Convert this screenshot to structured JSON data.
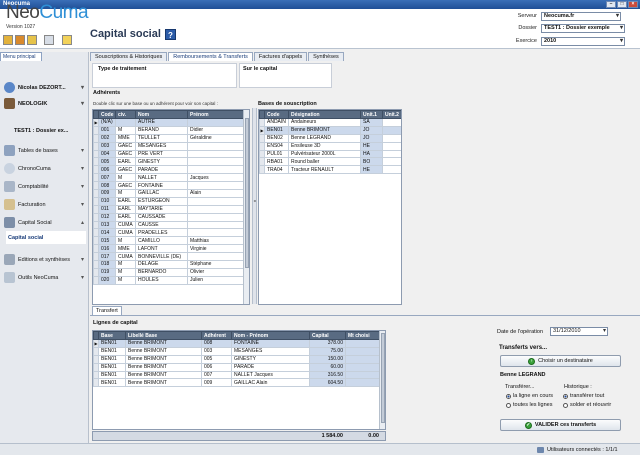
{
  "window": {
    "title": "Neocuma"
  },
  "header": {
    "logo_neo": "Neo",
    "logo_cuma": "Cuma",
    "version": "Version 1027",
    "page_title": "Capital social",
    "help": "?",
    "server_label": "Serveur",
    "server_value": "Neocuma.fr",
    "dossier_label": "Dossier",
    "dossier_value": "TEST1 : Dossier exemple",
    "exercice_label": "Exercice",
    "exercice_value": "2010"
  },
  "nav": {
    "tab_label": "Menu principal",
    "user": "Nicolas DEZORT...",
    "company": "NEOLOGIK",
    "dossier": "TEST1 : Dossier ex...",
    "items": [
      {
        "label": "Tables de bases"
      },
      {
        "label": "ChronoCuma"
      },
      {
        "label": "Comptabilité"
      },
      {
        "label": "Facturation"
      },
      {
        "label": "Capital Social"
      },
      {
        "label": "Capital social"
      },
      {
        "label": "Editions et synthèses"
      },
      {
        "label": "Outils NeoCuma"
      }
    ]
  },
  "tabs": [
    "Souscriptions & Historiques",
    "Remboursements & Transferts",
    "Factures d'appels",
    "Synthèses"
  ],
  "type_traitement": {
    "label": "Type de traitement"
  },
  "sur_capital": {
    "label": "Sur le capital"
  },
  "adherents": {
    "label": "Adhérents",
    "hint": "Double clic sur une base ou un adhérent pour voir son capital :",
    "columns": [
      "Code",
      "civ.",
      "Nom",
      "Prénom"
    ],
    "rows": [
      [
        "(N/A)",
        "",
        "AUTRE",
        ""
      ],
      [
        "001",
        "M",
        "BERAND",
        "Didier"
      ],
      [
        "002",
        "MME",
        "TEULLET",
        "Géraldine"
      ],
      [
        "003",
        "GAEC",
        "MESANGES",
        ""
      ],
      [
        "004",
        "GAEC",
        "PRE VERT",
        ""
      ],
      [
        "005",
        "EARL",
        "GINESTY",
        ""
      ],
      [
        "006",
        "GAEC",
        "PARADE",
        ""
      ],
      [
        "007",
        "M",
        "NALLET",
        "Jacques"
      ],
      [
        "008",
        "GAEC",
        "FONTAINE",
        ""
      ],
      [
        "009",
        "M",
        "GAILLAC",
        "Alain"
      ],
      [
        "010",
        "EARL",
        "ESTURGEON",
        ""
      ],
      [
        "011",
        "EARL",
        "MAYTARIE",
        ""
      ],
      [
        "012",
        "EARL",
        "CAUSSADE",
        ""
      ],
      [
        "013",
        "CUMA",
        "CAUSSE",
        ""
      ],
      [
        "014",
        "CUMA",
        "PRADELLES",
        ""
      ],
      [
        "015",
        "M",
        "CAMILLO",
        "Matthias"
      ],
      [
        "016",
        "MME",
        "LAFONT",
        "Virginie"
      ],
      [
        "017",
        "CUMA",
        "BONNEVILLE (DE)",
        ""
      ],
      [
        "018",
        "M",
        "DELAGE",
        "Stéphane"
      ],
      [
        "019",
        "M",
        "BERNARDO",
        "Olivier"
      ],
      [
        "020",
        "M",
        "HOULES",
        "Julien"
      ]
    ]
  },
  "bases": {
    "label": "Bases de souscription",
    "columns": [
      "Code",
      "Désignation",
      "Unit.1",
      "Unit.2"
    ],
    "rows": [
      [
        "ANDAIN",
        "Andaineurs",
        "SA",
        ""
      ],
      [
        "BEN01",
        "Benne BRIMONT",
        "JO",
        ""
      ],
      [
        "BEN02",
        "Benne LEGRAND",
        "JO",
        ""
      ],
      [
        "ENS04",
        "Ensileuse 3D",
        "HE",
        ""
      ],
      [
        "PUL01",
        "Pulvérisateur 2000L",
        "HA",
        ""
      ],
      [
        "RBA01",
        "Round baller",
        "BO",
        ""
      ],
      [
        "TRA04",
        "Tracteur RENAULT",
        "HE",
        ""
      ]
    ]
  },
  "transfert_tab": "Transfert",
  "lignes": {
    "label": "Lignes de capital",
    "columns": [
      "Base",
      "Libellé Base",
      "Adhérent",
      "Nom - Prénom",
      "Capital",
      "Mt choisi"
    ],
    "rows": [
      [
        "BEN01",
        "Benne BRIMONT",
        "008",
        "FONTAINE",
        "378.00",
        ""
      ],
      [
        "BEN01",
        "Benne BRIMONT",
        "003",
        "MESANGES",
        "75.00",
        ""
      ],
      [
        "BEN01",
        "Benne BRIMONT",
        "005",
        "GINESTY",
        "150.00",
        ""
      ],
      [
        "BEN01",
        "Benne BRIMONT",
        "006",
        "PARADE",
        "60.00",
        ""
      ],
      [
        "BEN01",
        "Benne BRIMONT",
        "007",
        "NALLET Jacques",
        "316.50",
        ""
      ],
      [
        "BEN01",
        "Benne BRIMONT",
        "009",
        "GAILLAC Alain",
        "604.50",
        ""
      ]
    ],
    "total_capital": "1 584.00",
    "total_choisi": "0.00"
  },
  "transfer": {
    "date_label": "Date de l'opération",
    "date_value": "31/12/2010",
    "transferts_label": "Transferts vers...",
    "choose_btn": "Choisir un destinataire",
    "dest_name": "Benne LEGRAND",
    "transferer_label": "Transférer...",
    "opt1": "la ligne en cours",
    "opt2": "toutes les lignes",
    "historique_label": "Historique :",
    "opt3": "transférer tout",
    "opt4": "solder et réouvrir",
    "validate_btn": "VALIDER ces transferts"
  },
  "status": {
    "users": "Utilisateurs connectés : 1/1/1"
  },
  "colors": {
    "header_blue": "#596b82",
    "selection": "#ccd9ec",
    "brand": "#2e8fd6"
  }
}
